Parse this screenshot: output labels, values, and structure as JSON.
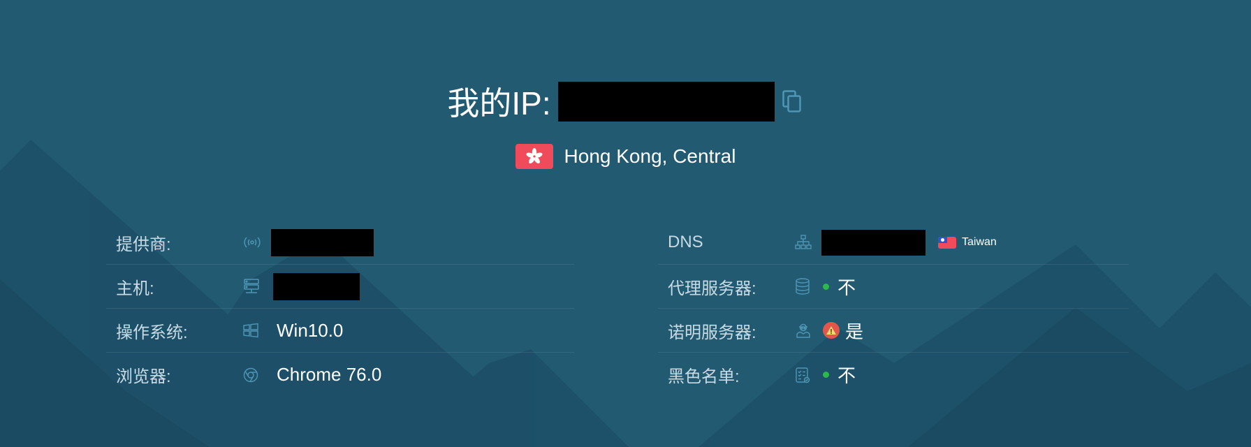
{
  "header": {
    "ip_label": "我的IP:",
    "ip_value": "[redacted]",
    "location": "Hong Kong, Central"
  },
  "left_rows": [
    {
      "label": "提供商:",
      "icon": "signal-broadcast-icon",
      "value": "[redacted]"
    },
    {
      "label": "主机:",
      "icon": "server-icon",
      "value": "[redacted]"
    },
    {
      "label": "操作系统:",
      "icon": "windows-icon",
      "value": "Win10.0"
    },
    {
      "label": "浏览器:",
      "icon": "chrome-icon",
      "value": "Chrome 76.0"
    }
  ],
  "right_rows": [
    {
      "label": "DNS",
      "icon": "network-tree-icon",
      "value": "[redacted]",
      "country": "Taiwan"
    },
    {
      "label": "代理服务器:",
      "icon": "database-icon",
      "value": "不",
      "status": "ok"
    },
    {
      "label": "诺明服务器:",
      "icon": "user-secret-icon",
      "value": "是",
      "status": "warning"
    },
    {
      "label": "黑色名单:",
      "icon": "checklist-icon",
      "value": "不",
      "status": "ok"
    }
  ],
  "colors": {
    "background": "#225a72",
    "mountain": "#1b4d63",
    "status_ok": "#2eb84b",
    "status_warning": "#e2574c",
    "icon": "#4f96b4",
    "flag_red": "#ef4b5b"
  }
}
